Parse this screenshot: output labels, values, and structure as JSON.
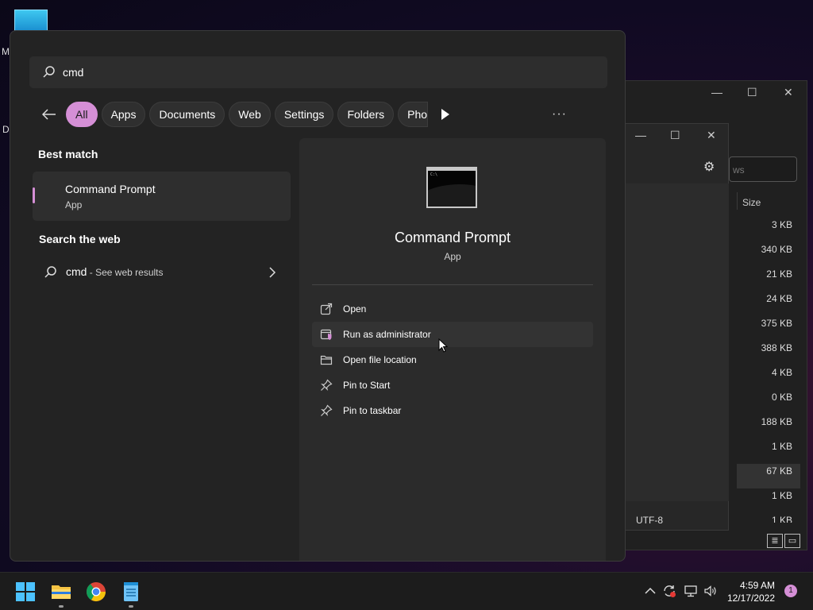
{
  "desktop": {
    "side_letters": [
      "M",
      "Da"
    ]
  },
  "search": {
    "query": "cmd"
  },
  "filters": {
    "items": [
      "All",
      "Apps",
      "Documents",
      "Web",
      "Settings",
      "Folders",
      "Pho"
    ],
    "active": "All",
    "more_label": "···"
  },
  "best_match": {
    "section_title": "Best match",
    "name": "Command Prompt",
    "type": "App"
  },
  "web_search": {
    "section_title": "Search the web",
    "query": "cmd",
    "suffix": " - See web results"
  },
  "preview": {
    "title": "Command Prompt",
    "subtitle": "App",
    "actions": [
      {
        "label": "Open",
        "icon": "open-external-icon"
      },
      {
        "label": "Run as administrator",
        "icon": "shield-admin-icon"
      },
      {
        "label": "Open file location",
        "icon": "folder-icon"
      },
      {
        "label": "Pin to Start",
        "icon": "pin-icon"
      },
      {
        "label": "Pin to taskbar",
        "icon": "pin-icon"
      }
    ]
  },
  "background_explorer": {
    "column_header": "Size",
    "search_placeholder": "ws",
    "sizes": [
      "3 KB",
      "340 KB",
      "21 KB",
      "24 KB",
      "375 KB",
      "388 KB",
      "4 KB",
      "0 KB",
      "188 KB",
      "1 KB",
      "67 KB",
      "1 KB",
      "1 KB"
    ]
  },
  "notepad": {
    "encoding": "UTF-8"
  },
  "taskbar": {
    "time": "4:59 AM",
    "date": "12/17/2022",
    "notification_count": "1"
  },
  "colors": {
    "accent": "#d58fd6",
    "panel": "#232323",
    "taskbar": "#1c1c1c"
  }
}
